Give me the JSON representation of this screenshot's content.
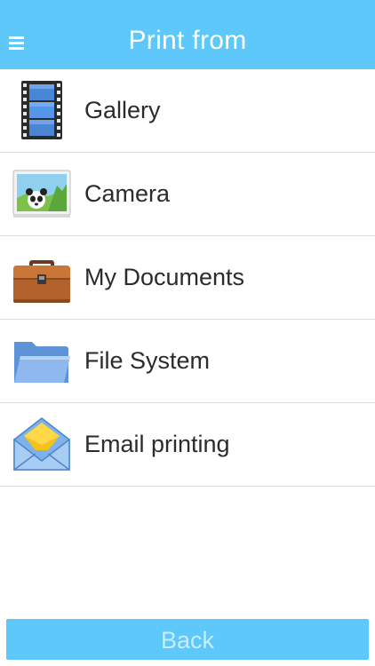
{
  "header": {
    "title": "Print from",
    "menu_icon": "hamburger-menu-icon"
  },
  "items": [
    {
      "label": "Gallery",
      "icon": "film-strip-icon"
    },
    {
      "label": "Camera",
      "icon": "panda-photo-icon"
    },
    {
      "label": "My Documents",
      "icon": "briefcase-icon"
    },
    {
      "label": "File System",
      "icon": "folder-icon"
    },
    {
      "label": "Email printing",
      "icon": "envelope-icon"
    }
  ],
  "footer": {
    "back_label": "Back"
  },
  "colors": {
    "header_bg": "#5ec8fb",
    "button_bg": "#5ec8fb",
    "button_text": "#c9ecfe",
    "divider": "#dcdcdc",
    "label_text": "#2b2b2b"
  }
}
